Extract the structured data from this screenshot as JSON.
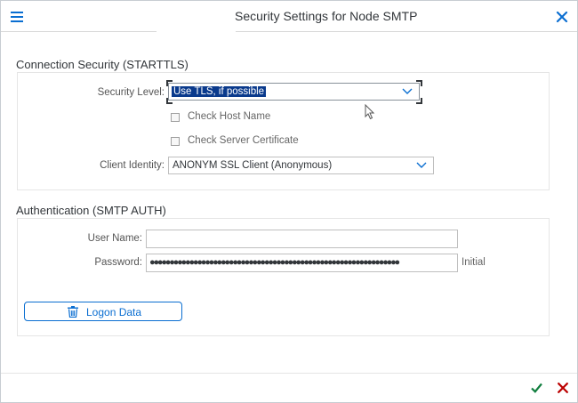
{
  "dialog": {
    "title": "Security Settings for Node SMTP"
  },
  "connection_security": {
    "heading": "Connection Security (STARTTLS)",
    "security_level_label": "Security Level:",
    "security_level_value": "Use TLS, if possible",
    "check_host_name_label": "Check Host Name",
    "check_host_name_checked": false,
    "check_server_cert_label": "Check Server Certificate",
    "check_server_cert_checked": false,
    "client_identity_label": "Client Identity:",
    "client_identity_value": "ANONYM SSL Client (Anonymous)"
  },
  "authentication": {
    "heading": "Authentication (SMTP AUTH)",
    "user_name_label": "User Name:",
    "user_name_value": "",
    "password_label": "Password:",
    "password_mask": "●●●●●●●●●●●●●●●●●●●●●●●●●●●●●●●●●●●●●●●●●●●●●●●●●●●●●●●●●●●●●●●",
    "password_status": "Initial",
    "logon_data_button": "Logon Data"
  },
  "icons": {
    "menu": "menu-icon",
    "close": "close-icon",
    "dropdown": "chevron-down-icon",
    "trash": "trash-icon",
    "ok": "checkmark-icon",
    "cancel": "cancel-icon",
    "cursor": "mouse-pointer-icon"
  },
  "colors": {
    "accent": "#0a6ed1",
    "selection": "#0a3a8c",
    "ok": "#107e3e",
    "cancel": "#bb0000"
  }
}
